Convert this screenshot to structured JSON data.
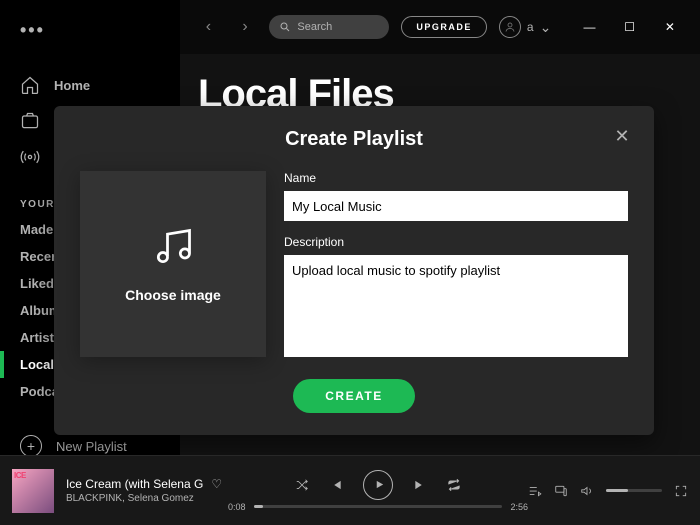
{
  "sidebar": {
    "nav": [
      {
        "label": "Home"
      },
      {
        "label": "Browse"
      },
      {
        "label": "Radio"
      }
    ],
    "section_title": "YOUR LIBRARY",
    "library": [
      {
        "label": "Made For You"
      },
      {
        "label": "Recently Played"
      },
      {
        "label": "Liked Songs"
      },
      {
        "label": "Albums"
      },
      {
        "label": "Artists"
      },
      {
        "label": "Local Files",
        "active": true
      },
      {
        "label": "Podcasts"
      }
    ],
    "new_playlist_label": "New Playlist"
  },
  "topbar": {
    "search_placeholder": "Search",
    "upgrade_label": "UPGRADE",
    "user_label": "a"
  },
  "main": {
    "title": "Local Files"
  },
  "modal": {
    "title": "Create Playlist",
    "choose_image_label": "Choose image",
    "name_label": "Name",
    "name_value": "My Local Music",
    "description_label": "Description",
    "description_value": "Upload local music to spotify playlist",
    "create_label": "CREATE"
  },
  "player": {
    "track_title": "Ice Cream (with Selena G",
    "track_artist": "BLACKPINK, Selena Gomez",
    "elapsed": "0:08",
    "duration": "2:56"
  }
}
